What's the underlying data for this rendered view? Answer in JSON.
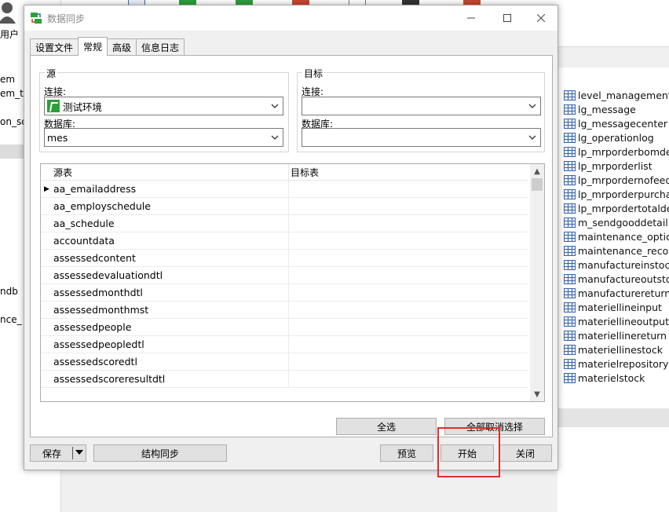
{
  "background": {
    "user_label": "用户",
    "tree": [
      "em",
      "em_te",
      "on_sc",
      "ndb",
      "nce_"
    ],
    "tables": [
      "level_management",
      "lg_message",
      "lg_messagecenter",
      "lg_operationlog",
      "lp_mrporderbomde",
      "lp_mrporderlist",
      "lp_mrpordernofeed",
      "lp_mrporderpurchas",
      "lp_mrpordertotaldet",
      "m_sendgooddetail",
      "maintenance_option",
      "maintenance_record",
      "manufactureinstock",
      "manufactureoutstoc",
      "manufacturereturn",
      "materiellineinput",
      "materiellineoutput",
      "materiellinereturn",
      "materiellinestock",
      "materielrepository",
      "materielstock"
    ]
  },
  "dialog": {
    "title": "数据同步",
    "tabs": [
      {
        "label": "设置文件"
      },
      {
        "label": "常规"
      },
      {
        "label": "高级"
      },
      {
        "label": "信息日志"
      }
    ],
    "source": {
      "group_title": "源",
      "connection_label": "连接:",
      "connection_value": "测试环境",
      "database_label": "数据库:",
      "database_value": "mes"
    },
    "target": {
      "group_title": "目标",
      "connection_label": "连接:",
      "connection_value": "",
      "database_label": "数据库:",
      "database_value": ""
    },
    "grid": {
      "col_source": "源表",
      "col_target": "目标表",
      "rows": [
        {
          "source": "aa_emailaddress",
          "target": ""
        },
        {
          "source": "aa_employschedule",
          "target": ""
        },
        {
          "source": "aa_schedule",
          "target": ""
        },
        {
          "source": "accountdata",
          "target": ""
        },
        {
          "source": "assessedcontent",
          "target": ""
        },
        {
          "source": "assessedevaluationdtl",
          "target": ""
        },
        {
          "source": "assessedmonthdtl",
          "target": ""
        },
        {
          "source": "assessedmonthmst",
          "target": ""
        },
        {
          "source": "assessedpeople",
          "target": ""
        },
        {
          "source": "assessedpeopledtl",
          "target": ""
        },
        {
          "source": "assessedscoredtl",
          "target": ""
        },
        {
          "source": "assessedscoreresultdtl",
          "target": ""
        }
      ]
    },
    "buttons": {
      "select_all": "全选",
      "deselect_all": "全部取消选择",
      "save": "保存",
      "structure_sync": "结构同步",
      "preview": "预览",
      "start": "开始",
      "close": "关闭"
    }
  },
  "colors": {
    "highlight": "#e52c2c"
  }
}
